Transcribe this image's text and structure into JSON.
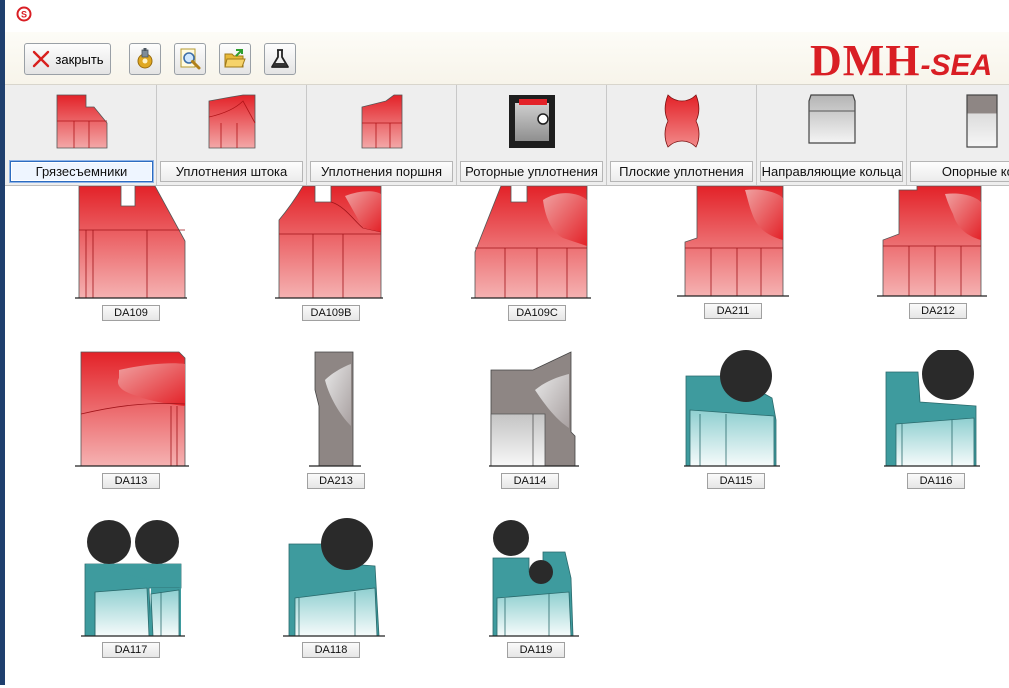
{
  "toolbar": {
    "close_label": "закрыть",
    "logo_main": "DMH",
    "logo_suffix": "-SEA"
  },
  "tabs": [
    {
      "label": "Грязесъемники",
      "active": true
    },
    {
      "label": "Уплотнения штока",
      "active": false
    },
    {
      "label": "Уплотнения поршня",
      "active": false
    },
    {
      "label": "Роторные уплотнения",
      "active": false
    },
    {
      "label": "Плоские уплотнения",
      "active": false
    },
    {
      "label": "Направляющие кольца",
      "active": false
    },
    {
      "label": "Опорные кол",
      "active": false
    }
  ],
  "items": [
    {
      "code": "DA109"
    },
    {
      "code": "DA109B"
    },
    {
      "code": "DA109C"
    },
    {
      "code": "DA211"
    },
    {
      "code": "DA212"
    },
    {
      "code": "DA113"
    },
    {
      "code": "DA213"
    },
    {
      "code": "DA114"
    },
    {
      "code": "DA115"
    },
    {
      "code": "DA116"
    },
    {
      "code": "DA117"
    },
    {
      "code": "DA118"
    },
    {
      "code": "DA119"
    }
  ],
  "colors": {
    "seal_red": "#e32228",
    "seal_gray": "#8e8684",
    "seal_teal": "#3e9b9e",
    "oring": "#2a2a2a",
    "logo_red": "#d91e24"
  }
}
